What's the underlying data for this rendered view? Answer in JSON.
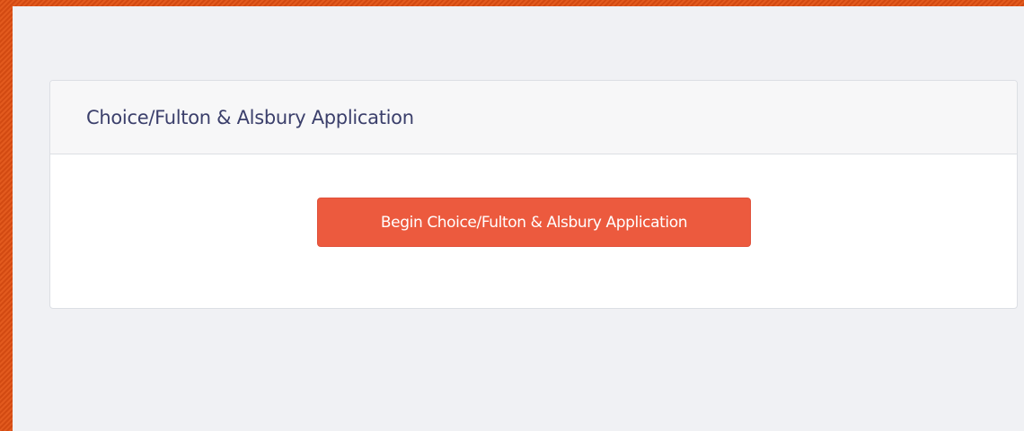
{
  "panel": {
    "title": "Choice/Fulton & Alsbury Application",
    "begin_button_label": "Begin Choice/Fulton & Alsbury Application"
  },
  "colors": {
    "accent": "#ec5a3e",
    "frame": "#d24a12",
    "background": "#f0f1f4",
    "title_text": "#3b3f6b"
  }
}
